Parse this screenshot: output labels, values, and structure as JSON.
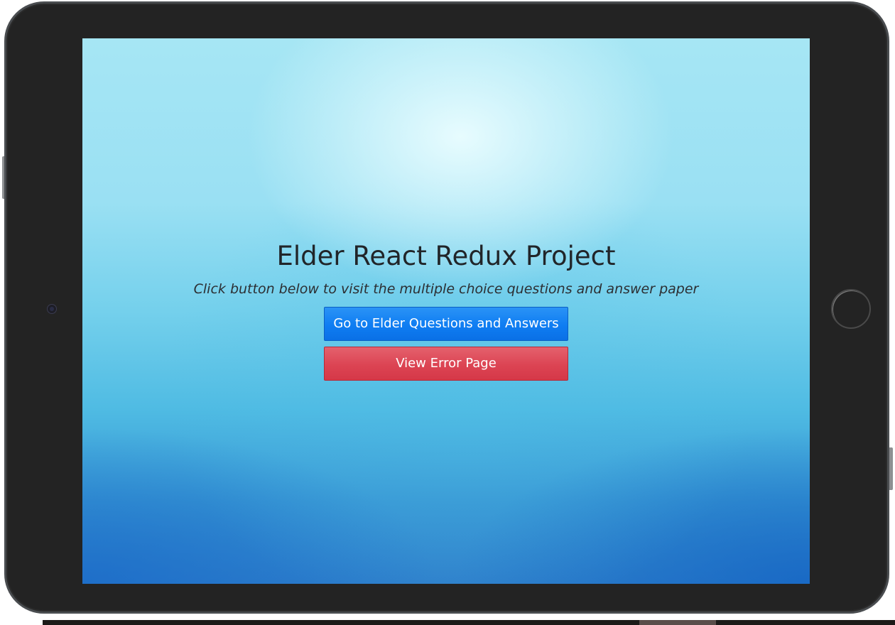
{
  "page": {
    "title": "Elder React Redux Project",
    "subtitle": "Click button below to visit the multiple choice questions and answer paper"
  },
  "actions": {
    "primary_label": "Go to Elder Questions and Answers",
    "danger_label": "View Error Page"
  },
  "colors": {
    "primary": "#0f7df2",
    "danger": "#dc4453",
    "text": "#212529",
    "bezel": "#232323"
  },
  "icons": {
    "camera": "camera-icon",
    "home": "home-button"
  }
}
